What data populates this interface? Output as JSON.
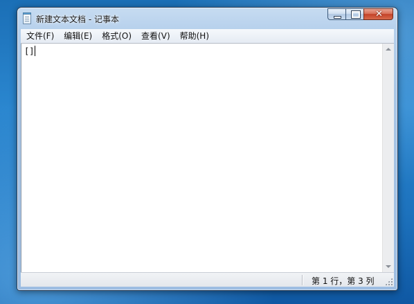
{
  "window": {
    "title": "新建文本文档 - 记事本",
    "close_glyph": "✕"
  },
  "menu": {
    "items": [
      {
        "label": "文件(F)"
      },
      {
        "label": "编辑(E)"
      },
      {
        "label": "格式(O)"
      },
      {
        "label": "查看(V)"
      },
      {
        "label": "帮助(H)"
      }
    ]
  },
  "editor": {
    "content": "[]"
  },
  "status": {
    "position": "第 1 行，第 3 列"
  },
  "colors": {
    "desktop": "#1b6fb6",
    "window_frame": "#a9c6e6",
    "close_button": "#c34128"
  },
  "icons": [
    "notepad-icon",
    "minimize-icon",
    "maximize-icon",
    "close-icon",
    "scroll-up-arrow-icon",
    "scroll-down-arrow-icon",
    "resize-grip-icon"
  ]
}
